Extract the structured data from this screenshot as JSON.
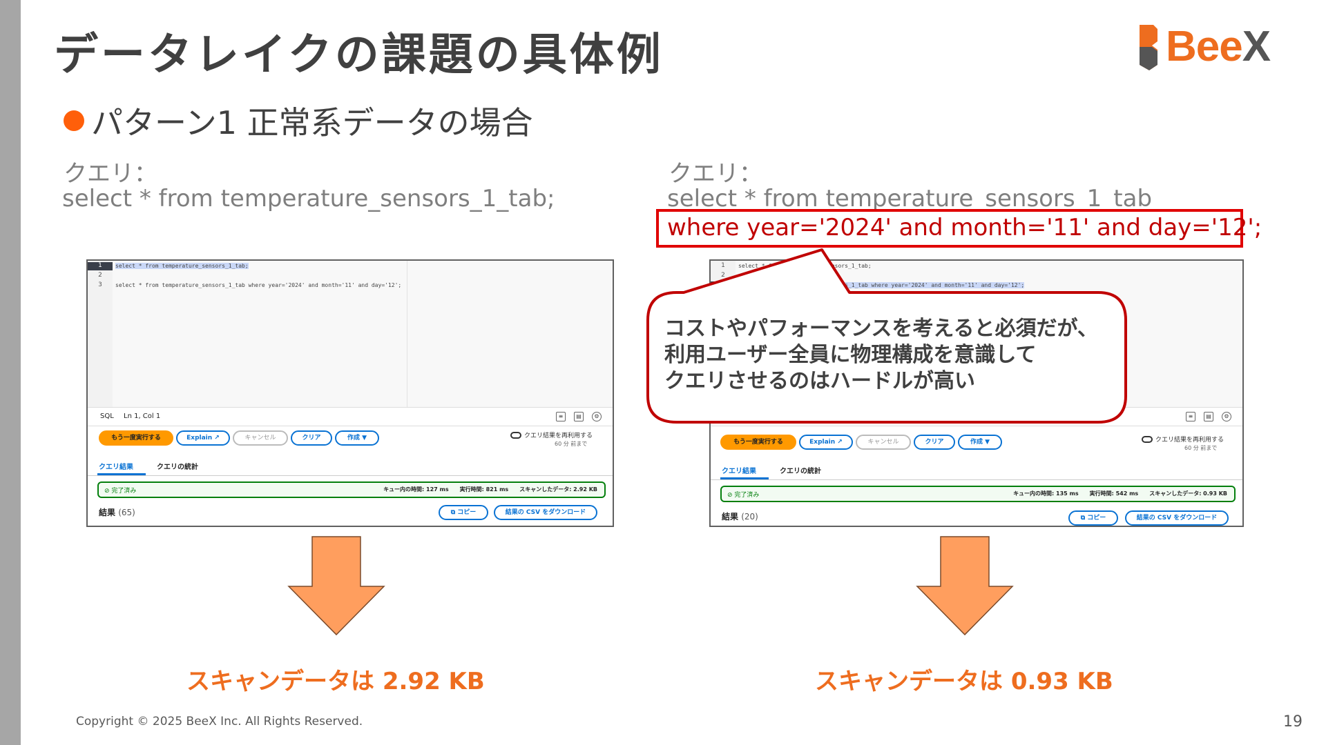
{
  "slide": {
    "title": "データレイクの課題の具体例",
    "logo_text_main": "Bee",
    "logo_text_x": "X",
    "subtitle": "パターン1 正常系データの場合",
    "left": {
      "query_label": "クエリ：",
      "query_line1": "select * from temperature_sensors_1_tab;",
      "scan_result": "スキャンデータは 2.92 KB"
    },
    "right": {
      "query_label": "クエリ：",
      "query_line1": "select * from temperature_sensors_1_tab",
      "query_line2": "where year='2024' and month='11' and day='12';",
      "scan_result": "スキャンデータは 0.93 KB"
    },
    "callout": {
      "line1": "コストやパフォーマンスを考えると必須だが、",
      "line2": "利用ユーザー全員に物理構成を意識して",
      "line3": "クエリさせるのはハードルが高い"
    },
    "copyright": "Copyright © 2025 BeeX Inc. All Rights Reserved.",
    "page_number": "19",
    "colors": {
      "accent": "#ee6d1f",
      "highlight_red": "#e00000",
      "arrow_fill": "#ff9e5e"
    }
  },
  "left_shot": {
    "code_lines": [
      {
        "no": "1",
        "text": "select * from temperature_sensors_1_tab;"
      },
      {
        "no": "2",
        "text": ""
      },
      {
        "no": "3",
        "text": "select * from temperature_sensors_1_tab where year='2024' and month='11' and day='12';"
      }
    ],
    "status_lang": "SQL",
    "status_pos": "Ln 1, Col 1",
    "buttons": {
      "rerun": "もう一度実行する",
      "explain": "Explain ↗",
      "cancel": "キャンセル",
      "clear": "クリア",
      "create": "作成 ▼"
    },
    "reuse_label": "クエリ結果を再利用する",
    "reuse_sub": "60 分 前まで",
    "tab_results": "クエリ結果",
    "tab_stats": "クエリの統計",
    "status_ok": "完了済み",
    "stats": "キュー内の時間: 127 ms　　実行時間: 821 ms　　スキャンしたデータ: 2.92 KB",
    "result_label": "結果",
    "result_count": "(65)",
    "copy_btn": "コピー",
    "download_btn": "結果の CSV をダウンロード"
  },
  "right_shot": {
    "code_lines": [
      {
        "no": "1",
        "text": "select * from temperature_sensors_1_tab;"
      },
      {
        "no": "2",
        "text": ""
      },
      {
        "no": "3",
        "text": "select * from temperature_sensors_1_tab where year='2024' and month='11' and day='12';"
      }
    ],
    "buttons": {
      "rerun": "もう一度実行する",
      "explain": "Explain ↗",
      "cancel": "キャンセル",
      "clear": "クリア",
      "create": "作成 ▼"
    },
    "reuse_label": "クエリ結果を再利用する",
    "reuse_sub": "60 分 前まで",
    "tab_results": "クエリ結果",
    "tab_stats": "クエリの統計",
    "status_ok": "完了済み",
    "stats": "キュー内の時間: 135 ms　　実行時間: 542 ms　　スキャンしたデータ: 0.93 KB",
    "result_label": "結果",
    "result_count": "(20)",
    "copy_btn": "コピー",
    "download_btn": "結果の CSV をダウンロード"
  }
}
